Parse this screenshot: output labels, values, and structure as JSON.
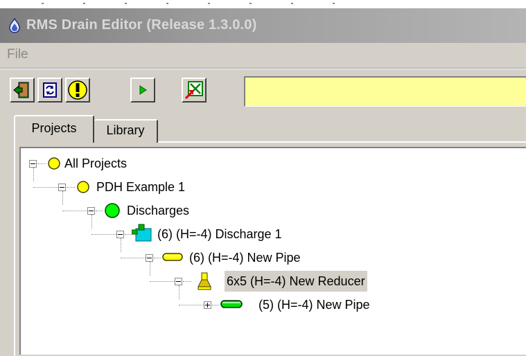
{
  "window": {
    "title": "RMS Drain Editor (Release 1.3.0.0)"
  },
  "menu": [
    {
      "label": "File"
    }
  ],
  "toolbar": {
    "buttons": [
      {
        "icon": "exit-door-icon"
      },
      {
        "icon": "refresh-icon"
      },
      {
        "icon": "warning-icon"
      },
      {
        "icon": "play-icon"
      },
      {
        "icon": "export-icon"
      }
    ],
    "status_text": ""
  },
  "tabs": [
    {
      "label": "Projects",
      "active": true
    },
    {
      "label": "Library",
      "active": false
    }
  ],
  "tree": [
    {
      "label": "All Projects",
      "icon": "yellow-circle-icon",
      "depth": 0,
      "expanded": true
    },
    {
      "label": "PDH Example 1",
      "icon": "yellow-circle-icon",
      "depth": 1,
      "expanded": true
    },
    {
      "label": "Discharges",
      "icon": "green-circle-icon",
      "depth": 2,
      "expanded": true
    },
    {
      "label": "(6) (H=-4) Discharge 1",
      "icon": "discharge-tank-icon",
      "depth": 3,
      "expanded": true
    },
    {
      "label": "(6) (H=-4) New Pipe",
      "icon": "yellow-pipe-icon",
      "depth": 4,
      "expanded": true
    },
    {
      "label": "6x5 (H=-4) New Reducer",
      "icon": "reducer-icon",
      "depth": 5,
      "expanded": true,
      "selected": true
    },
    {
      "label": "(5) (H=-4) New Pipe",
      "icon": "green-pipe-icon",
      "depth": 6,
      "expanded": false
    }
  ],
  "colors": {
    "status_field": "#ffff99",
    "node_yellow": "#ffff00",
    "node_green": "#00ff00",
    "discharge_cyan": "#00d0e0",
    "selection": "#d4d0c8"
  }
}
